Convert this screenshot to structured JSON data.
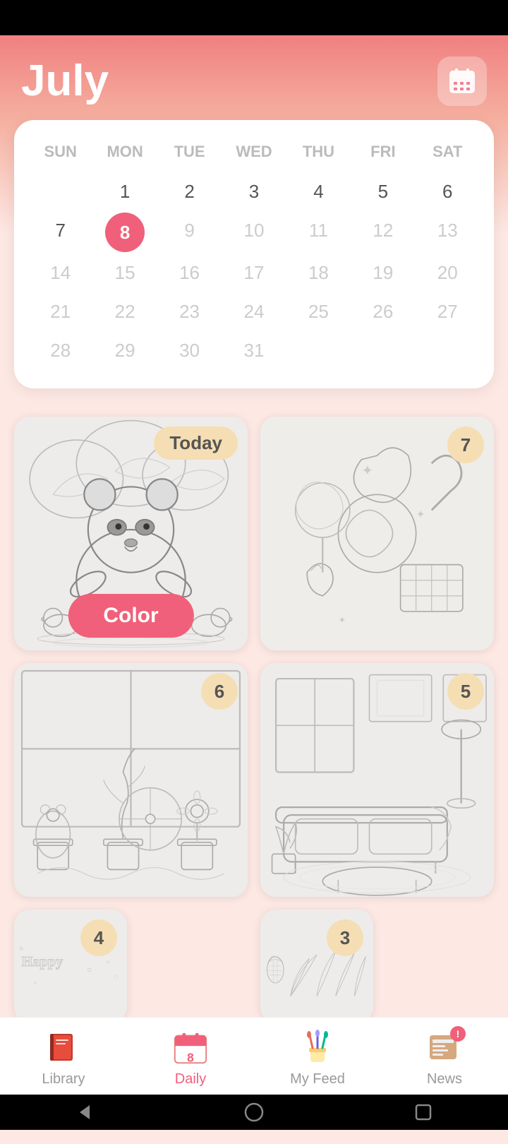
{
  "header": {
    "month": "July",
    "calendar_icon": "calendar"
  },
  "calendar": {
    "days_of_week": [
      "SUN",
      "MON",
      "TUE",
      "WED",
      "THU",
      "FRI",
      "SAT"
    ],
    "selected_day": 8,
    "weeks": [
      [
        null,
        1,
        2,
        3,
        4,
        5,
        6
      ],
      [
        7,
        8,
        9,
        10,
        11,
        12,
        13
      ],
      [
        14,
        15,
        16,
        17,
        18,
        19,
        20
      ],
      [
        21,
        22,
        23,
        24,
        25,
        26,
        27
      ],
      [
        28,
        29,
        30,
        31,
        null,
        null,
        null
      ]
    ]
  },
  "coloring_cards": [
    {
      "id": "today",
      "badge": "Today",
      "badge_type": "today",
      "action": "Color",
      "description": "Panda coloring page"
    },
    {
      "id": "day7",
      "badge": "7",
      "badge_type": "number",
      "description": "Sweets coloring page"
    },
    {
      "id": "day6",
      "badge": "6",
      "badge_type": "number",
      "description": "Garden coloring page"
    },
    {
      "id": "day5",
      "badge": "5",
      "badge_type": "number",
      "description": "Living room coloring page"
    },
    {
      "id": "day4",
      "badge": "4",
      "badge_type": "number",
      "description": "Happy birthday coloring page"
    },
    {
      "id": "day3",
      "badge": "3",
      "badge_type": "number",
      "description": "Tropical plants coloring page"
    }
  ],
  "bottom_nav": {
    "items": [
      {
        "id": "library",
        "label": "Library",
        "icon": "book",
        "active": false
      },
      {
        "id": "daily",
        "label": "Daily",
        "icon": "calendar-daily",
        "active": true
      },
      {
        "id": "myfeed",
        "label": "My Feed",
        "icon": "paint-brushes",
        "active": false
      },
      {
        "id": "news",
        "label": "News",
        "icon": "news",
        "active": false,
        "has_badge": true
      }
    ]
  },
  "system_nav": {
    "back": "◀",
    "home": "●",
    "recent": "■"
  }
}
